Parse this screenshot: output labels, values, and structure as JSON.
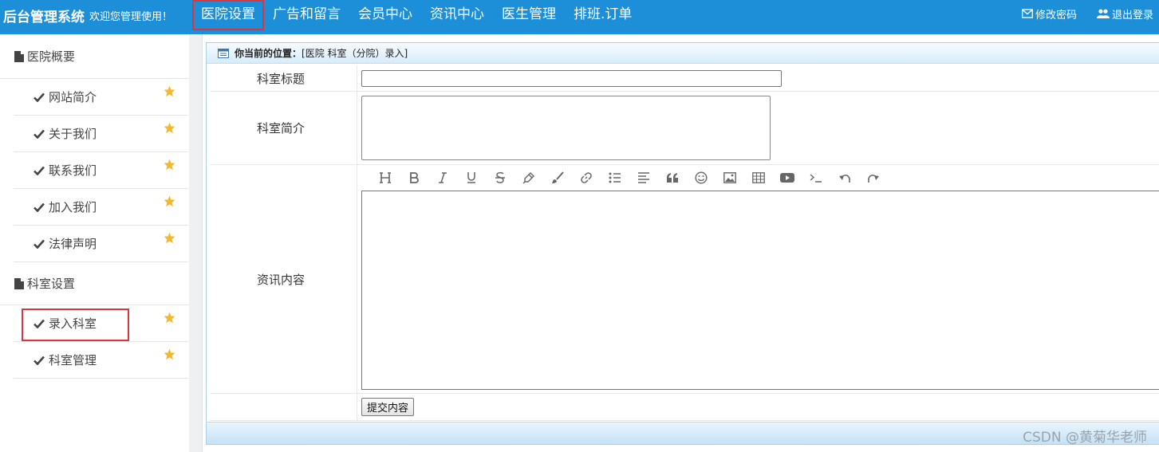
{
  "header": {
    "title": "后台管理系统",
    "welcome": "欢迎您管理使用！",
    "nav": [
      "医院设置",
      "广告和留言",
      "会员中心",
      "资讯中心",
      "医生管理",
      "排班.订单"
    ],
    "active_nav_index": 0,
    "change_password": "修改密码",
    "logout": "退出登录"
  },
  "sidebar": {
    "group1": {
      "title": "医院概要",
      "items": [
        "网站简介",
        "关于我们",
        "联系我们",
        "加入我们",
        "法律声明"
      ]
    },
    "group2": {
      "title": "科室设置",
      "items": [
        "录入科室",
        "科室管理"
      ]
    },
    "active_item": "录入科室"
  },
  "main": {
    "location_label": "你当前的位置：",
    "location_path": "[医院 科室（分院）录入]",
    "fields": {
      "title_label": "科室标题",
      "title_value": "",
      "intro_label": "科室简介",
      "intro_value": "",
      "content_label": "资讯内容",
      "submit_label": "提交内容"
    },
    "editor_tools": [
      "heading-icon",
      "bold-icon",
      "italic-icon",
      "underline-icon",
      "strikethrough-icon",
      "highlighter-icon",
      "brush-icon",
      "link-icon",
      "bullet-list-icon",
      "align-left-icon",
      "quote-icon",
      "emoji-icon",
      "image-icon",
      "table-icon",
      "video-icon",
      "code-icon",
      "undo-icon",
      "redo-icon"
    ]
  },
  "watermark": "CSDN @黄菊华老师",
  "colors": {
    "topbar": "#1c8fd8",
    "active_border": "#d9363e",
    "star": "#f5b82a"
  }
}
